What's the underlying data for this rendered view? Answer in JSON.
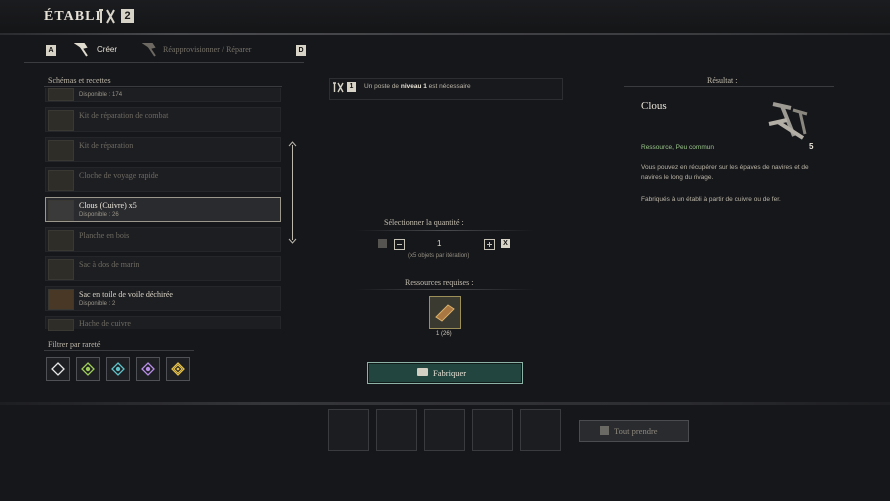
{
  "header": {
    "title": "ÉTABLI",
    "level": "2"
  },
  "tabs": {
    "prev_key": "A",
    "create_label": "Créer",
    "repair_label": "Réapprovisionner / Réparer",
    "next_key": "D"
  },
  "schemas": {
    "header": "Schémas et recettes",
    "items": [
      {
        "name": "",
        "sub": "Disponible : 174",
        "available": true
      },
      {
        "name": "Kit de réparation de combat",
        "sub": "",
        "available": false
      },
      {
        "name": "Kit de réparation",
        "sub": "",
        "available": false
      },
      {
        "name": "Cloche de voyage rapide",
        "sub": "",
        "available": false
      },
      {
        "name": "Clous (Cuivre) x5",
        "sub": "Disponible : 26",
        "available": true,
        "selected": true
      },
      {
        "name": "Planche en bois",
        "sub": "",
        "available": false
      },
      {
        "name": "Sac à dos de marin",
        "sub": "",
        "available": false
      },
      {
        "name": "Sac en toile de voile déchirée",
        "sub": "Disponible : 2",
        "available": true
      },
      {
        "name": "Hache de cuivre",
        "sub": "",
        "available": false
      }
    ]
  },
  "filter": {
    "header": "Filtrer par rareté",
    "colors": [
      "#e8e8e8",
      "#9ecf5a",
      "#5fc3c9",
      "#b98ee8",
      "#e3c04c"
    ]
  },
  "requirement": {
    "prefix": "Un poste de ",
    "level": "niveau 1",
    "suffix": " est nécessaire",
    "icon_level": "1"
  },
  "quantity": {
    "title": "Sélectionner la quantité :",
    "value": "1",
    "note": "(x5 objets par itération)",
    "minus_key": "",
    "plus_key": "X"
  },
  "resources": {
    "title": "Ressources requises :",
    "count": "1 (26)"
  },
  "craft": {
    "label": "Fabriquer"
  },
  "result": {
    "title": "Résultat :",
    "name": "Clous",
    "qty": "5",
    "type": "Ressource, Peu commun",
    "desc1": "Vous pouvez en récupérer sur les épaves de navires et de navires le long du rivage.",
    "desc2": "Fabriqués à un établi à partir de cuivre ou de fer."
  },
  "take": {
    "label": "Tout prendre"
  }
}
